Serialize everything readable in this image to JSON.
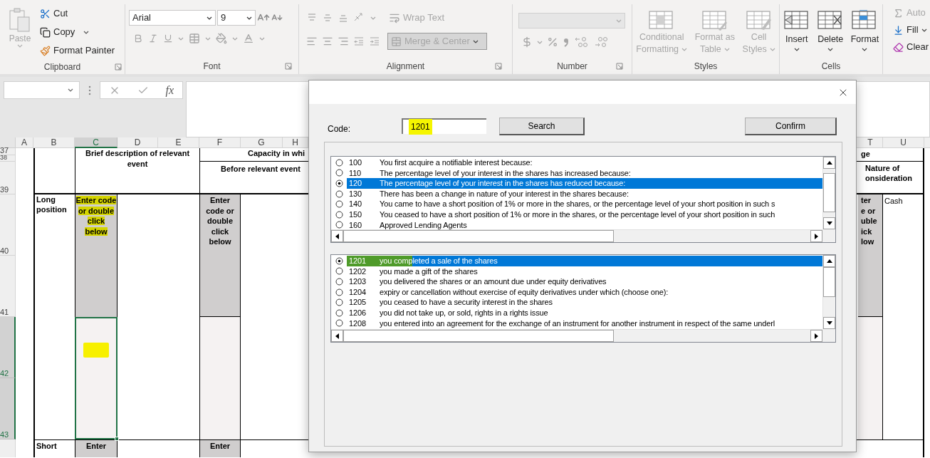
{
  "ribbon": {
    "clipboard": {
      "label": "Clipboard",
      "paste": {
        "label": "Paste",
        "disabled": true
      },
      "cut": "Cut",
      "copy": "Copy",
      "format_painter": "Format Painter"
    },
    "font": {
      "label": "Font",
      "font_name": "Arial",
      "font_size": "9",
      "tools_disabled": true
    },
    "alignment": {
      "label": "Alignment",
      "wrap_text": "Wrap Text",
      "merge": "Merge & Center",
      "tools_disabled": true
    },
    "number": {
      "label": "Number",
      "tools_disabled": true
    },
    "styles": {
      "label": "Styles",
      "tools_disabled": true,
      "buttons": [
        {
          "kind": "conditional",
          "lines": [
            "Conditional",
            "Formatting"
          ]
        },
        {
          "kind": "table",
          "lines": [
            "Format as",
            "Table"
          ]
        },
        {
          "kind": "cell_styles",
          "lines": [
            "Cell",
            "Styles"
          ]
        }
      ]
    },
    "cells": {
      "label": "Cells",
      "buttons": [
        {
          "kind": "insert",
          "label": "Insert"
        },
        {
          "kind": "delete",
          "label": "Delete"
        },
        {
          "kind": "format",
          "label": "Format"
        }
      ]
    },
    "editing": {
      "buttons": [
        {
          "kind": "autosum",
          "label": "Auto",
          "disabled": true
        },
        {
          "kind": "fill",
          "label": "Fill",
          "disabled": false
        },
        {
          "kind": "clear",
          "label": "Clear",
          "disabled": false
        }
      ]
    }
  },
  "formula_bar": {
    "fx": "fx"
  },
  "sheet": {
    "columns": [
      {
        "label": "A",
        "selected": false
      },
      {
        "label": "B",
        "selected": false
      },
      {
        "label": "C",
        "selected": true
      },
      {
        "label": "D",
        "selected": false
      },
      {
        "label": "E",
        "selected": false
      },
      {
        "label": "F",
        "selected": false
      },
      {
        "label": "G",
        "selected": false
      },
      {
        "label": "H",
        "selected": false
      },
      {
        "label": "T",
        "selected": false
      },
      {
        "label": "U",
        "selected": false
      }
    ],
    "rows": [
      {
        "label": "37",
        "selected": false
      },
      {
        "label": "38",
        "selected": false
      },
      {
        "label": "39",
        "selected": false
      },
      {
        "label": "40",
        "selected": false
      },
      {
        "label": "41",
        "selected": false
      },
      {
        "label": "42",
        "selected": true
      },
      {
        "label": "43",
        "selected": true
      }
    ],
    "header_description": "Brief description of relevant event",
    "header_capacity": "Capacity in whi",
    "header_before": "Before relevant event",
    "header_t_top": "ge",
    "header_nature": [
      "Nature of",
      "onsideration"
    ],
    "long_position": "Long position",
    "prompt_c": {
      "text": "Enter code or double click below",
      "highlighted": true
    },
    "prompt_f": {
      "text": "Enter code or double click below",
      "highlighted": false
    },
    "prompt_t": [
      "ter",
      "e or",
      "uble",
      "ick",
      "low"
    ],
    "consideration": "Cash",
    "selected_cell_highlighted": true,
    "short_position": "Short",
    "prompt_c_short": "Enter",
    "prompt_f_short": "Enter"
  },
  "dialog": {
    "code_label": "Code:",
    "code_value": "1201",
    "code_highlighted": true,
    "search": "Search",
    "confirm": "Confirm",
    "categories": [
      {
        "code": "100",
        "text": "You first acquire a notifiable interest because:",
        "selected": false
      },
      {
        "code": "110",
        "text": "The percentage level of your interest in the shares has increased because:",
        "selected": false
      },
      {
        "code": "120",
        "text": "The percentage level of your interest in the shares has reduced because:",
        "selected": true
      },
      {
        "code": "130",
        "text": "There has been a change in nature of your interest in the shares because:",
        "selected": false
      },
      {
        "code": "140",
        "text": "You came to have a short position of 1% or more in the shares, or the percentage level of your short position in such s",
        "selected": false
      },
      {
        "code": "150",
        "text": "You ceased to have a short position of 1% or more in the shares, or the percentage level of your short position in such",
        "selected": false
      },
      {
        "code": "160",
        "text": "Approved Lending Agents",
        "selected": false
      }
    ],
    "reasons": [
      {
        "code": "1201",
        "text": "you completed a sale of the shares",
        "selected": true,
        "highlighted": true
      },
      {
        "code": "1202",
        "text": "you made a gift of the shares",
        "selected": false,
        "highlighted": false
      },
      {
        "code": "1203",
        "text": "you delivered the shares or an amount due under equity derivatives",
        "selected": false,
        "highlighted": false
      },
      {
        "code": "1204",
        "text": "expiry or cancellation without exercise of equity derivatives under which (choose one):",
        "selected": false,
        "highlighted": false
      },
      {
        "code": "1205",
        "text": "you ceased to have a security interest in the shares",
        "selected": false,
        "highlighted": false
      },
      {
        "code": "1206",
        "text": "you did not take up, or sold, rights in a rights issue",
        "selected": false,
        "highlighted": false
      },
      {
        "code": "1208",
        "text": "you entered into an agreement for the exchange of an instrument for another instrument in respect of the same underl",
        "selected": false,
        "highlighted": false
      }
    ]
  }
}
